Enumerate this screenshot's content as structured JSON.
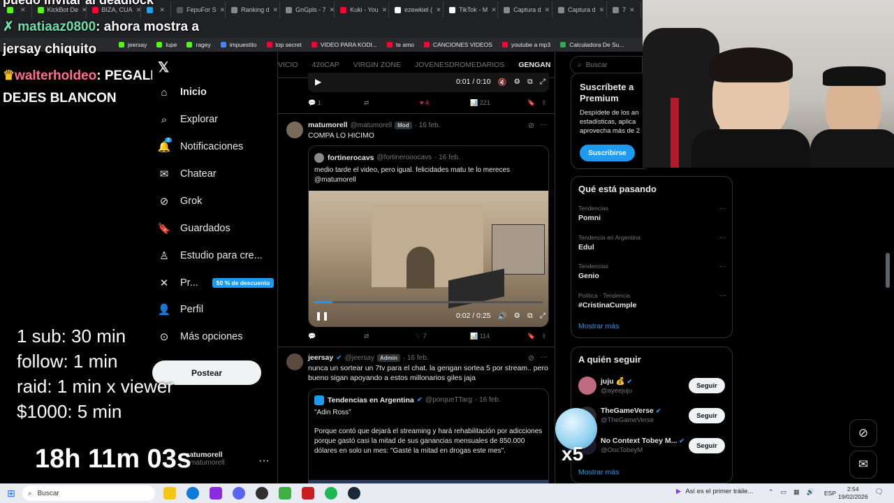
{
  "browser": {
    "tabs": [
      {
        "label": "",
        "color": "#53fc18"
      },
      {
        "label": "KickBot De",
        "color": "#53fc18"
      },
      {
        "label": "BIZA, CUA",
        "color": "#ff0033"
      },
      {
        "label": "",
        "color": "#1da1f2"
      },
      {
        "label": "FepuFor S",
        "color": "#555"
      },
      {
        "label": "Ranking d",
        "color": "#888"
      },
      {
        "label": "GnGpls - 7",
        "color": "#888"
      },
      {
        "label": "Kuki - You",
        "color": "#ff0033"
      },
      {
        "label": "ezewkiel (",
        "color": "#fff"
      },
      {
        "label": "TikTok - M",
        "color": "#fff"
      },
      {
        "label": "Captura d",
        "color": "#888"
      },
      {
        "label": "Captura d",
        "color": "#888"
      },
      {
        "label": "7",
        "color": "#888"
      }
    ],
    "bookmarks": [
      {
        "label": "jeersay",
        "color": "#53fc18"
      },
      {
        "label": "lupe",
        "color": "#53fc18"
      },
      {
        "label": "ragey",
        "color": "#53fc18"
      },
      {
        "label": "impuestito",
        "color": "#4285f4"
      },
      {
        "label": "top secret",
        "color": "#ff0033"
      },
      {
        "label": "VIDEO PARA KODI...",
        "color": "#ff0033"
      },
      {
        "label": "te amo",
        "color": "#ff0033"
      },
      {
        "label": "CANCIONES VIDEOS",
        "color": "#ff0033"
      },
      {
        "label": "youtube a mp3",
        "color": "#ff0033"
      },
      {
        "label": "Calculadora De Su...",
        "color": "#34a853"
      }
    ]
  },
  "chat": {
    "top_cut": "puedo invitar al deadlock",
    "msg1_user": "matiaaz0800",
    "msg1_text": ": ahora mostra a",
    "msg1_cont": "jersay chiquito",
    "msg2_user": "walterholdeo",
    "msg2_text": ": PEGALE NO TE",
    "msg2_cont": "DEJES BLANCON"
  },
  "nav": {
    "items": [
      {
        "label": "Inicio",
        "icon": "home-icon"
      },
      {
        "label": "Explorar",
        "icon": "search-icon"
      },
      {
        "label": "Notificaciones",
        "icon": "bell-icon",
        "badge": "2"
      },
      {
        "label": "Chatear",
        "icon": "mail-icon"
      },
      {
        "label": "Grok",
        "icon": "grok-icon"
      },
      {
        "label": "Guardados",
        "icon": "bookmark-icon"
      },
      {
        "label": "Estudio para cre...",
        "icon": "studio-icon"
      },
      {
        "label": "Pr...",
        "icon": "x-icon",
        "discount": "50 % de descuento"
      },
      {
        "label": "Perfil",
        "icon": "person-icon"
      },
      {
        "label": "Más opciones",
        "icon": "more-icon"
      }
    ],
    "post_label": "Postear",
    "account_name": "matumorell",
    "account_handle": "@matumorell"
  },
  "feed": {
    "tabs": [
      "VICIO",
      "420CAP",
      "VIRGIN ZONE",
      "JOVENESDROMEDARIOS",
      "GENGAN"
    ],
    "video1": {
      "time": "0:01 / 0:10"
    },
    "actions1": {
      "replies": "1",
      "likes": "4",
      "views": "221"
    },
    "tweet1": {
      "name": "matumorell",
      "handle": "@matumorell",
      "role": "Mod",
      "date": "16 feb.",
      "text": "COMPA LO HICIMO",
      "quote_name": "fortinerocavs",
      "quote_handle": "@fortinerooocavs",
      "quote_date": "16 feb.",
      "quote_text": "medio tarde el video, pero igual. felicidades matu te lo mereces @matumorell",
      "video_time": "0:02 / 0:25",
      "likes": "7",
      "views": "114"
    },
    "tweet2": {
      "name": "jeersay",
      "handle": "@jeersay",
      "role": "Admin",
      "date": "16 feb.",
      "text": "nunca un sortear un 7tv para el chat. la gengan sortea 5 por stream.. pero bueno sigan apoyando a estos millonarios giles  jaja",
      "quote_name": "Tendencias en Argentina",
      "quote_handle": "@porqueTTarg",
      "quote_date": "16 feb.",
      "quote_title": "\"Adin Ross\"",
      "quote_text": "Porque contó que dejará el streaming y hará rehabilitación por adicciones porque gastó casi la mitad de sus ganancias mensuales de 850.000 dólares en solo un mes: \"Gasté la mitad en drogas este mes\"."
    }
  },
  "sidebar": {
    "search_placeholder": "Buscar",
    "premium_title": "Suscríbete a Premium",
    "premium_text": "Despídete de los an estadísticas, aplica aprovecha más de 2",
    "premium_button": "Suscribirse",
    "trends_title": "Qué está pasando",
    "trends": [
      {
        "category": "Tendencias",
        "name": "Pomni"
      },
      {
        "category": "Tendencia en Argentina",
        "name": "Edul"
      },
      {
        "category": "Tendencias",
        "name": "Genio"
      },
      {
        "category": "Política · Tendencia",
        "name": "#CristinaCumple"
      }
    ],
    "show_more": "Mostrar más",
    "follow_title": "A quién seguir",
    "follows": [
      {
        "name": "juju 💰",
        "handle": "@ayeejuju"
      },
      {
        "name": "TheGameVerse",
        "handle": "@TheGameVerse"
      },
      {
        "name": "No Context Tobey M...",
        "handle": "@OocTobeyM"
      }
    ],
    "follow_label": "Seguir",
    "show_more2": "Mostrar más"
  },
  "overlay": {
    "rules": [
      "1 sub: 30 min",
      "follow: 1 min",
      "raid: 1 min x viewer",
      "$1000: 5 min"
    ],
    "timer": "18h 11m 03s",
    "multiplier": "x5"
  },
  "taskbar": {
    "search": "Buscar",
    "news": "Así es el primer tráile...",
    "lang": "ESP",
    "time": "2:54",
    "date": "19/02/2026"
  }
}
